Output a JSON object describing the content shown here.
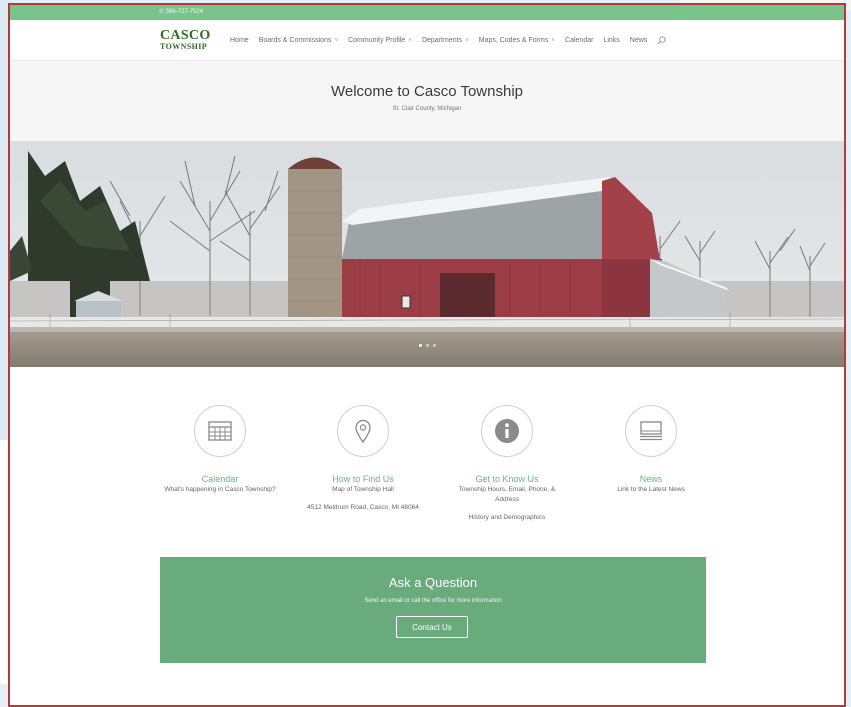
{
  "topbar": {
    "phone": "586-727-7524"
  },
  "logo": {
    "line1": "CASCO",
    "line2": "TOWNSHIP"
  },
  "nav": {
    "items": [
      {
        "label": "Home",
        "active": true,
        "dropdown": false
      },
      {
        "label": "Boards & Commissions",
        "active": false,
        "dropdown": true
      },
      {
        "label": "Community Profile",
        "active": false,
        "dropdown": true
      },
      {
        "label": "Departments",
        "active": false,
        "dropdown": true
      },
      {
        "label": "Maps, Codes & Forms",
        "active": false,
        "dropdown": true
      },
      {
        "label": "Calendar",
        "active": false,
        "dropdown": false
      },
      {
        "label": "Links",
        "active": false,
        "dropdown": false
      },
      {
        "label": "News",
        "active": false,
        "dropdown": false
      }
    ],
    "search_icon": "search-icon",
    "caret_glyph": "∨"
  },
  "welcome": {
    "title": "Welcome to Casco Township",
    "subtitle": "St. Clair County, Michigan"
  },
  "hero": {
    "slide_count": 3,
    "active_slide": 1
  },
  "features": [
    {
      "icon": "calendar-icon",
      "title": "Calendar",
      "desc": "What's happening in Casco Township?",
      "extra": ""
    },
    {
      "icon": "map-pin-icon",
      "title": "How to Find Us",
      "desc": "Map of Township Hall",
      "extra": "4512 Meldrum Road, Casco, MI 48064"
    },
    {
      "icon": "info-icon",
      "title": "Get to Know Us",
      "desc": "Township Hours, Email, Phone, & Address",
      "extra": "History and Demographics"
    },
    {
      "icon": "newspaper-icon",
      "title": "News",
      "desc": "Link to the Latest News",
      "extra": ""
    }
  ],
  "cta": {
    "title": "Ask a Question",
    "subtitle": "Send an email or call the office for more information",
    "button": "Contact Us"
  },
  "colors": {
    "accent": "#6ab57a",
    "topbar": "#79c48a",
    "cta_bg": "#6aab7e",
    "logo": "#2f6e24",
    "frame_border": "#b23a3a"
  }
}
